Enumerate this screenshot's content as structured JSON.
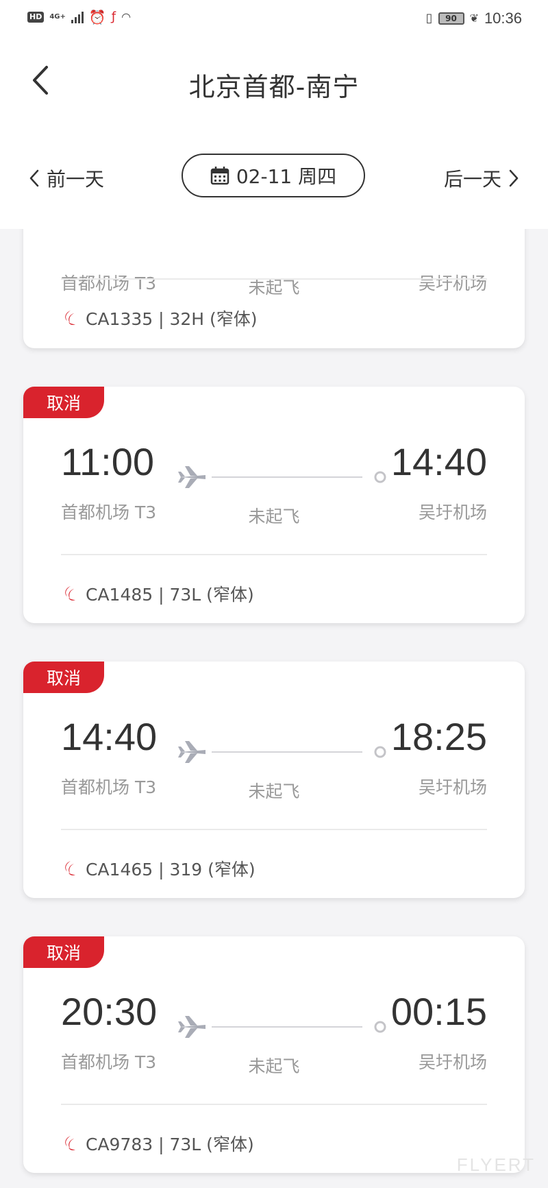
{
  "status_bar": {
    "hd": "HD",
    "network": "4G+",
    "battery": "90",
    "time": "10:36"
  },
  "header": {
    "title": "北京首都-南宁",
    "prev_day": "前一天",
    "next_day": "后一天",
    "date": "02-11 周四"
  },
  "flights": [
    {
      "tag": "",
      "dep_time": "",
      "arr_time": "",
      "dep_airport": "首都机场 T3",
      "arr_airport": "吴圩机场",
      "status": "未起飞",
      "info": "CA1335 | 32H (窄体)"
    },
    {
      "tag": "取消",
      "dep_time": "11:00",
      "arr_time": "14:40",
      "dep_airport": "首都机场 T3",
      "arr_airport": "吴圩机场",
      "status": "未起飞",
      "info": "CA1485 | 73L (窄体)"
    },
    {
      "tag": "取消",
      "dep_time": "14:40",
      "arr_time": "18:25",
      "dep_airport": "首都机场 T3",
      "arr_airport": "吴圩机场",
      "status": "未起飞",
      "info": "CA1465 | 319 (窄体)"
    },
    {
      "tag": "取消",
      "dep_time": "20:30",
      "arr_time": "00:15",
      "dep_airport": "首都机场 T3",
      "arr_airport": "吴圩机场",
      "status": "未起飞",
      "info": "CA9783 | 73L (窄体)"
    }
  ],
  "watermark": "FLYERT",
  "colors": {
    "accent": "#d9232d",
    "text": "#333333",
    "muted": "#999999",
    "background": "#f4f4f6"
  },
  "icons": [
    "back-chevron-icon",
    "calendar-icon",
    "chevron-left-icon",
    "chevron-right-icon",
    "airplane-icon",
    "airline-logo-icon"
  ]
}
